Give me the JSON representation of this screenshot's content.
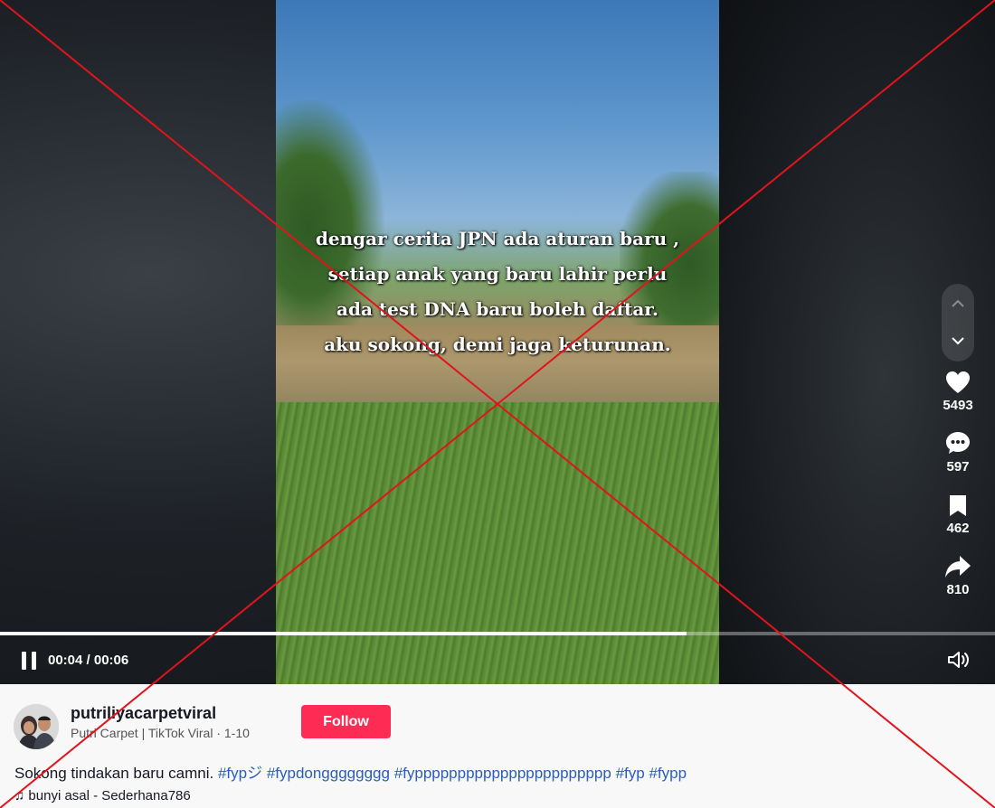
{
  "video": {
    "caption_lines": [
      "dengar cerita JPN ada aturan baru ,",
      "setiap anak yang baru lahir perlu",
      "ada test DNA baru boleh daftar.",
      "aku sokong, demi jaga keturunan."
    ]
  },
  "actions": {
    "likes": "5493",
    "comments": "597",
    "bookmarks": "462",
    "shares": "810"
  },
  "playback": {
    "time": "00:04 / 00:06",
    "progress": 0.69
  },
  "author": {
    "username": "putriliyacarpetviral",
    "subtitle": "Putri Carpet | TikTok Viral · 1-10",
    "follow_label": "Follow"
  },
  "description": {
    "text": "Sokong tindakan baru camni.",
    "hashtags": [
      "#fypジ",
      "#fypdongggggggg",
      "#fyppppppppppppppppppppppp",
      "#fyp",
      "#fypp"
    ]
  },
  "music": {
    "label": "bunyi asal - Sederhana786"
  },
  "colors": {
    "follow_button": "#fe2c55",
    "hashtag": "#2b5db9",
    "overlay_cross": "#e0141c"
  },
  "icons": {
    "nav_up": "chevron-up-icon",
    "nav_down": "chevron-down-icon",
    "like": "heart-icon",
    "comment": "comment-icon",
    "bookmark": "bookmark-icon",
    "share": "share-icon",
    "pause": "pause-icon",
    "volume": "volume-icon",
    "music": "music-note-icon"
  }
}
